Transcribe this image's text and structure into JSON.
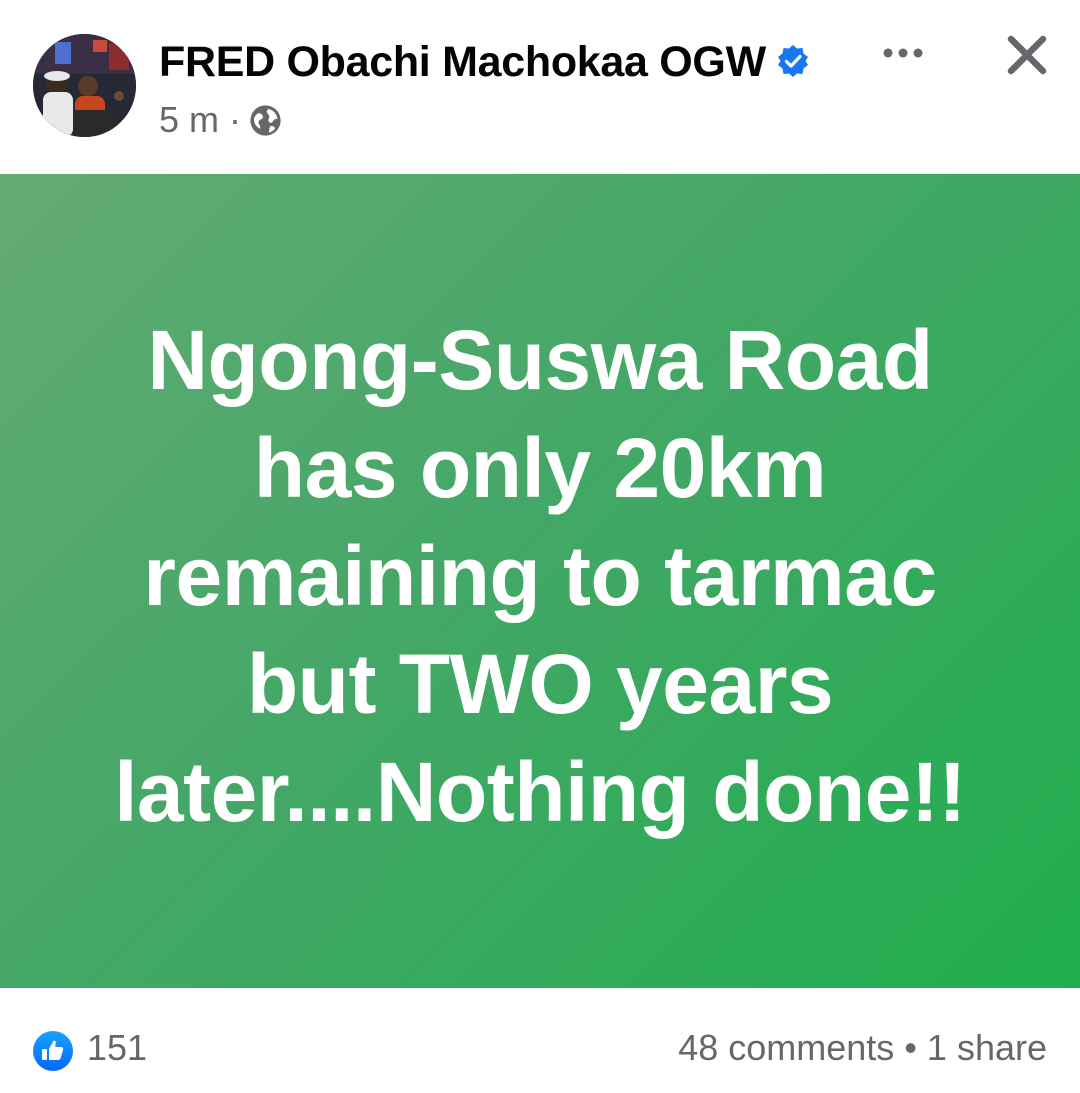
{
  "post": {
    "author": "FRED Obachi Machokaa OGW",
    "time": "5 m",
    "separator": "·",
    "text_lines": [
      "Ngong-Suswa Road",
      "has only 20km",
      "remaining to tarmac",
      "but TWO years",
      "later....Nothing done!!"
    ],
    "background_gradient": [
      "#64ab74",
      "#1fae4d"
    ]
  },
  "footer": {
    "like_count": "151",
    "comments": "48 comments",
    "bullet": "•",
    "shares": "1 share"
  },
  "icons": {
    "verified": "verified-badge-icon",
    "audience": "globe-icon",
    "more": "more-dots-icon",
    "close": "close-icon",
    "like": "thumbs-up-icon"
  },
  "colors": {
    "verified_blue": "#1877f2",
    "meta_gray": "#65676b",
    "name_black": "#050505"
  }
}
